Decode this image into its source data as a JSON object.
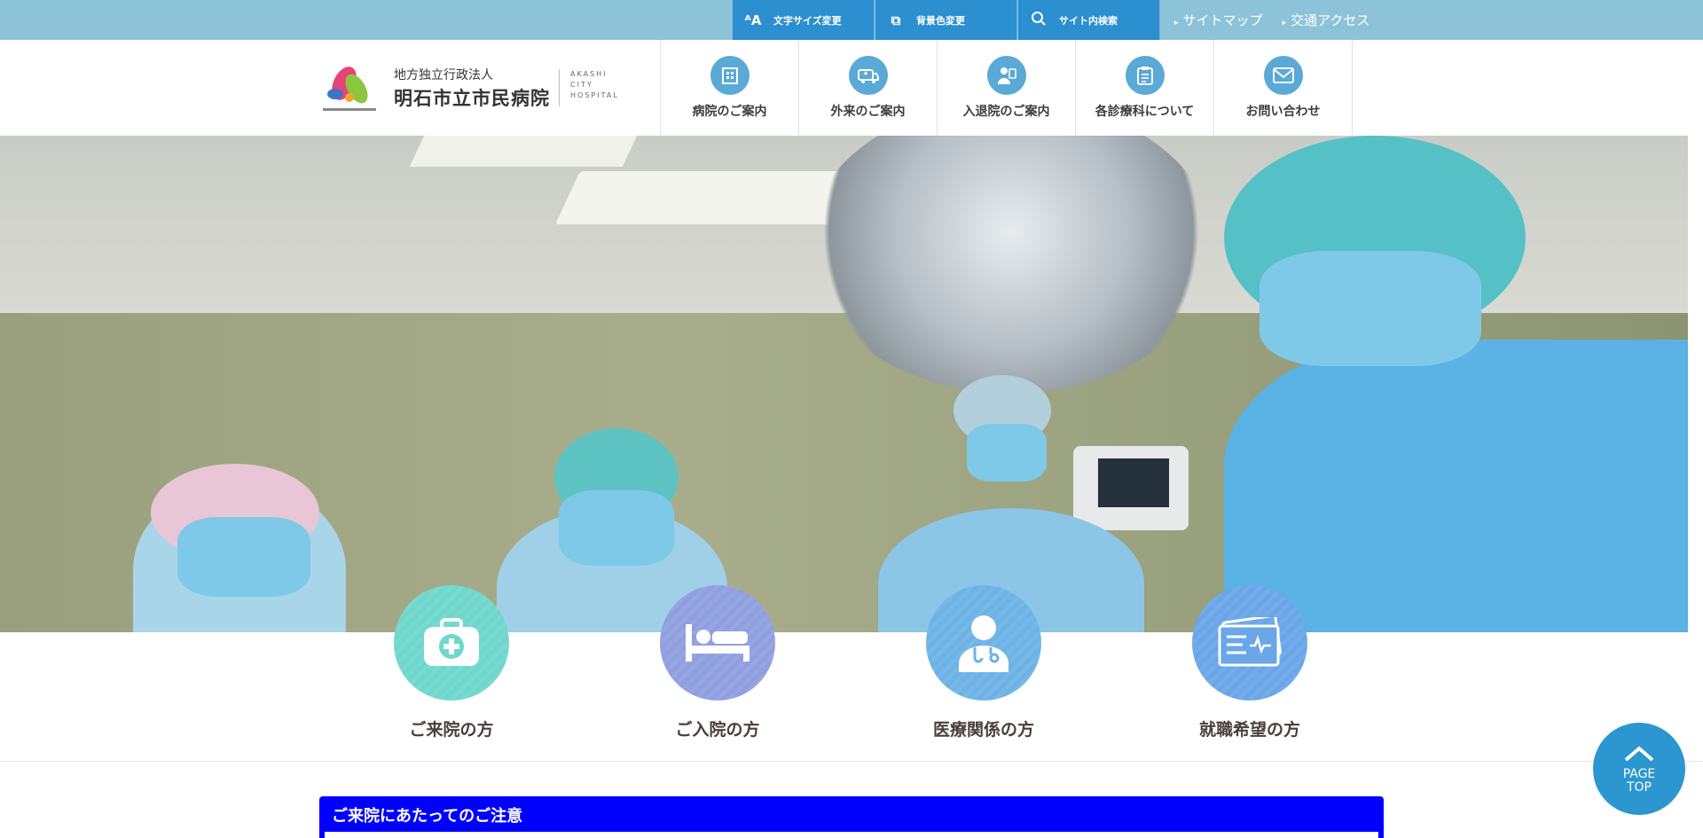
{
  "utility": {
    "font_size_label": "文字サイズ変更",
    "bg_color_label": "背景色変更",
    "search_label": "サイト内検索",
    "links": [
      "サイトマップ",
      "交通アクセス"
    ]
  },
  "logo": {
    "sub": "地方独立行政法人",
    "main": "明石市立市民病院",
    "en_lines": [
      "AKASHI",
      "CITY",
      "HOSPITAL"
    ]
  },
  "nav": [
    {
      "label": "病院のご案内",
      "icon": "building-icon"
    },
    {
      "label": "外来のご案内",
      "icon": "ambulance-icon"
    },
    {
      "label": "入退院のご案内",
      "icon": "patient-icon"
    },
    {
      "label": "各診療科について",
      "icon": "clipboard-icon"
    },
    {
      "label": "お問い合わせ",
      "icon": "mail-icon"
    }
  ],
  "categories": [
    {
      "label": "ご来院の方",
      "icon": "medical-kit-icon"
    },
    {
      "label": "ご入院の方",
      "icon": "bed-icon"
    },
    {
      "label": "医療関係の方",
      "icon": "doctor-icon"
    },
    {
      "label": "就職希望の方",
      "icon": "id-card-icon"
    }
  ],
  "notice": {
    "title": "ご来院にあたってのご注意"
  },
  "page_top": {
    "line1": "PAGE",
    "line2": "TOP"
  },
  "colors": {
    "topbar": "#8dc3d9",
    "utility_button": "#2b8fd0",
    "notice_bg": "#0000ff",
    "page_top": "#2b96cf"
  }
}
